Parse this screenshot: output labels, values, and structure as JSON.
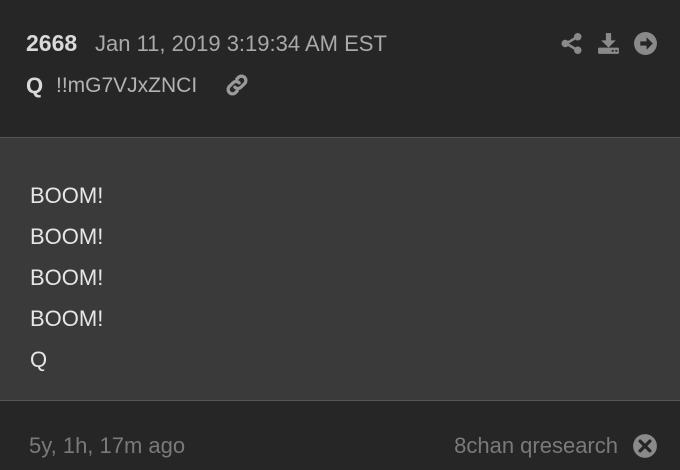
{
  "post": {
    "number": "2668",
    "date": "Jan 11, 2019 3:19:34 AM EST",
    "author": "Q",
    "tripcode": "!!mG7VJxZNCI",
    "lines": [
      "BOOM!",
      "BOOM!",
      "BOOM!",
      "BOOM!",
      "Q"
    ]
  },
  "footer": {
    "ago": "5y, 1h, 17m ago",
    "source": "8chan qresearch"
  },
  "icons": {
    "share": "share-icon",
    "download": "download-icon",
    "forward": "arrow-right-circle-icon",
    "link": "link-icon",
    "close": "close-circle-icon"
  },
  "colors": {
    "header_bg": "#262626",
    "body_bg": "#3a3a3a",
    "text_primary": "#e6e6e6",
    "text_muted": "#7a7a7a"
  }
}
